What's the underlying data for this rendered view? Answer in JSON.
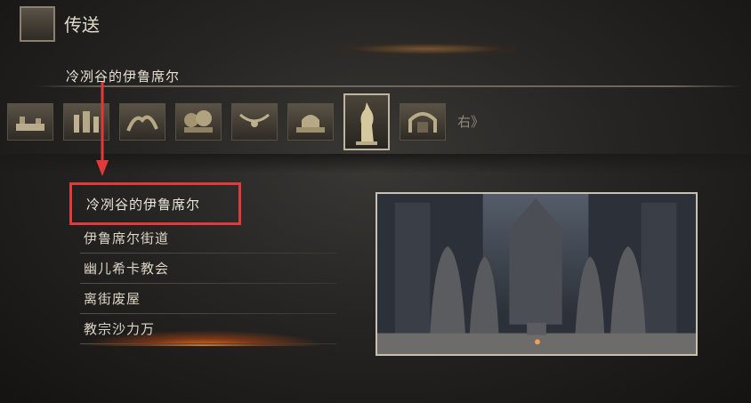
{
  "header": {
    "menu_icon": "bonfire-emblem-icon",
    "title": "传送"
  },
  "area": {
    "title": "冷冽谷的伊鲁席尔"
  },
  "tabs": {
    "icons": [
      "firelink-shrine-icon",
      "castle-icon",
      "tree-icon",
      "forest-icon",
      "cathedral-icon",
      "irithyll-icon",
      "irithyll-statue-icon",
      "gate-icon"
    ],
    "selected_index": 6,
    "next_label": "右》"
  },
  "locations": {
    "items": [
      {
        "label": "冷冽谷的伊鲁席尔",
        "selected": true
      },
      {
        "label": "伊鲁席尔街道",
        "selected": false
      },
      {
        "label": "幽儿希卡教会",
        "selected": false
      },
      {
        "label": "离街废屋",
        "selected": false
      },
      {
        "label": "教宗沙力万",
        "selected": false,
        "hovered": true
      }
    ]
  },
  "colors": {
    "highlight_box": "#e03a3a",
    "hover_glow": "#eb781e"
  }
}
